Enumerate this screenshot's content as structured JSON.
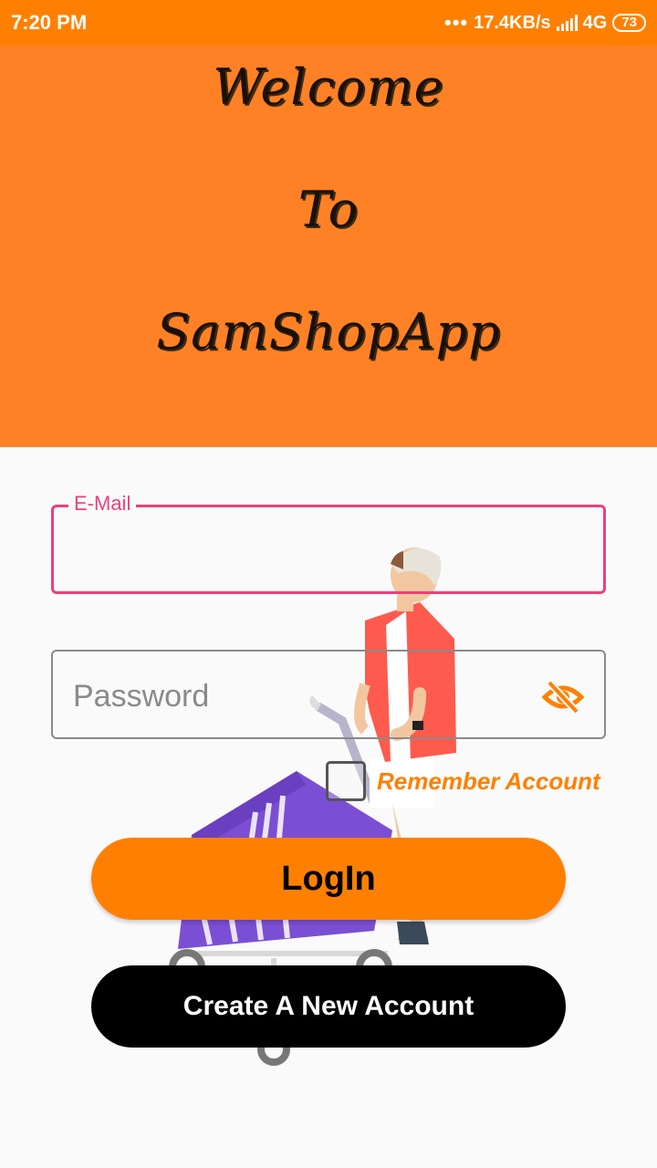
{
  "status_bar": {
    "time": "7:20 PM",
    "dots": "•••",
    "speed": "17.4KB/s",
    "network": "4G",
    "battery": "73"
  },
  "banner": {
    "line1": "Welcome",
    "line2": "To",
    "line3": "SamShopApp"
  },
  "form": {
    "email_label": "E-Mail",
    "password_placeholder": "Password",
    "remember_label": "Remember Account",
    "login_label": "LogIn",
    "create_label": "Create A New Account"
  },
  "colors": {
    "primary": "#ff8000",
    "focus": "#ec407a",
    "banner": "#ff8125"
  },
  "icons": {
    "password_toggle": "eye-off-icon"
  }
}
